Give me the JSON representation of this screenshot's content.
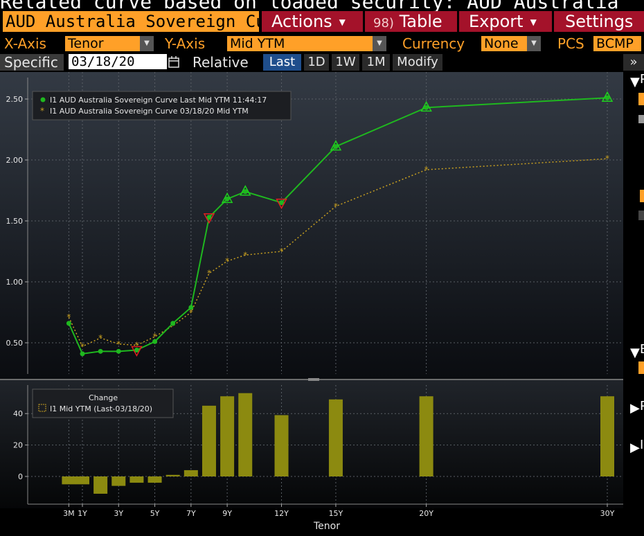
{
  "header": {
    "banner_text": "Related curve based on loaded security: AUD Australia"
  },
  "toolbar": {
    "security_field": "AUD Australia Sovereign Cu",
    "actions_label": "Actions",
    "table_num": "98)",
    "table_label": "Table",
    "export_label": "Export",
    "settings_label": "Settings"
  },
  "axes_bar": {
    "xaxis_label": "X-Axis",
    "xaxis_value": "Tenor",
    "yaxis_label": "Y-Axis",
    "yaxis_value": "Mid YTM",
    "currency_label": "Currency",
    "currency_value": "None",
    "pcs_label": "PCS",
    "pcs_value": "BCMP"
  },
  "date_bar": {
    "specific_label": "Specific",
    "date_value": "03/18/20",
    "relative_label": "Relative",
    "tabs": [
      "Last",
      "1D",
      "1W",
      "1M",
      "Modify"
    ],
    "active_tab": "Last",
    "more_label": "»"
  },
  "right_strip": {
    "letters": [
      "P",
      "B",
      "P",
      "I"
    ]
  },
  "colors": {
    "live": "#1fb81f",
    "hist": "#c8a020",
    "bar": "#8c8a10",
    "orange": "#ffa028",
    "red_btn": "#a4122a"
  },
  "chart_data": [
    {
      "type": "line",
      "x_categories": [
        "3M",
        "1Y",
        "3Y",
        "5Y",
        "7Y",
        "9Y",
        "12Y",
        "15Y",
        "20Y",
        "30Y"
      ],
      "xlabel": "Tenor",
      "ylabel": "",
      "ylim": [
        0.3,
        2.65
      ],
      "yticks": [
        "0.50",
        "1.00",
        "1.50",
        "2.00",
        "2.50"
      ],
      "legend": {
        "position": "top-left",
        "entries": [
          "I1 AUD Australia Sovereign Curve Last Mid YTM 11:44:17",
          "I1 AUD Australia Sovereign Curve 03/18/20 Mid YTM"
        ]
      },
      "series": [
        {
          "name": "I1 AUD Australia Sovereign Curve Last Mid YTM 11:44:17",
          "style": "solid",
          "tenor_years": [
            0.25,
            1,
            2,
            3,
            4,
            5,
            6,
            7,
            8,
            9,
            10,
            12,
            15,
            20,
            30
          ],
          "values": [
            0.66,
            0.41,
            0.43,
            0.43,
            0.44,
            0.51,
            0.66,
            0.79,
            1.53,
            1.68,
            1.74,
            1.65,
            2.11,
            2.43,
            2.51
          ],
          "markers": {
            "4": "down",
            "8": "down",
            "9": "up",
            "10": "up",
            "11": "down",
            "12": "up",
            "13": "up",
            "14": "up"
          }
        },
        {
          "name": "I1 AUD Australia Sovereign Curve 03/18/20 Mid YTM",
          "style": "dotted",
          "tenor_years": [
            0.25,
            1,
            2,
            3,
            4,
            5,
            6,
            7,
            8,
            9,
            10,
            12,
            15,
            20,
            30
          ],
          "values": [
            0.71,
            0.47,
            0.54,
            0.49,
            0.48,
            0.55,
            0.64,
            0.75,
            1.07,
            1.17,
            1.22,
            1.25,
            1.62,
            1.92,
            2.01
          ]
        }
      ]
    },
    {
      "type": "bar",
      "title": "Change",
      "xlabel": "Tenor",
      "ylim": [
        -15,
        55
      ],
      "yticks": [
        "0",
        "20",
        "40"
      ],
      "legend": {
        "position": "top-left",
        "entries": [
          "I1 Mid YTM (Last-03/18/20)"
        ]
      },
      "tenor_years": [
        0.25,
        1,
        2,
        3,
        4,
        5,
        6,
        7,
        8,
        9,
        10,
        12,
        15,
        20,
        30
      ],
      "values": [
        -5,
        -5,
        -11,
        -6,
        -4,
        -4,
        1,
        4,
        45,
        51,
        53,
        39,
        49,
        51,
        51
      ]
    }
  ]
}
